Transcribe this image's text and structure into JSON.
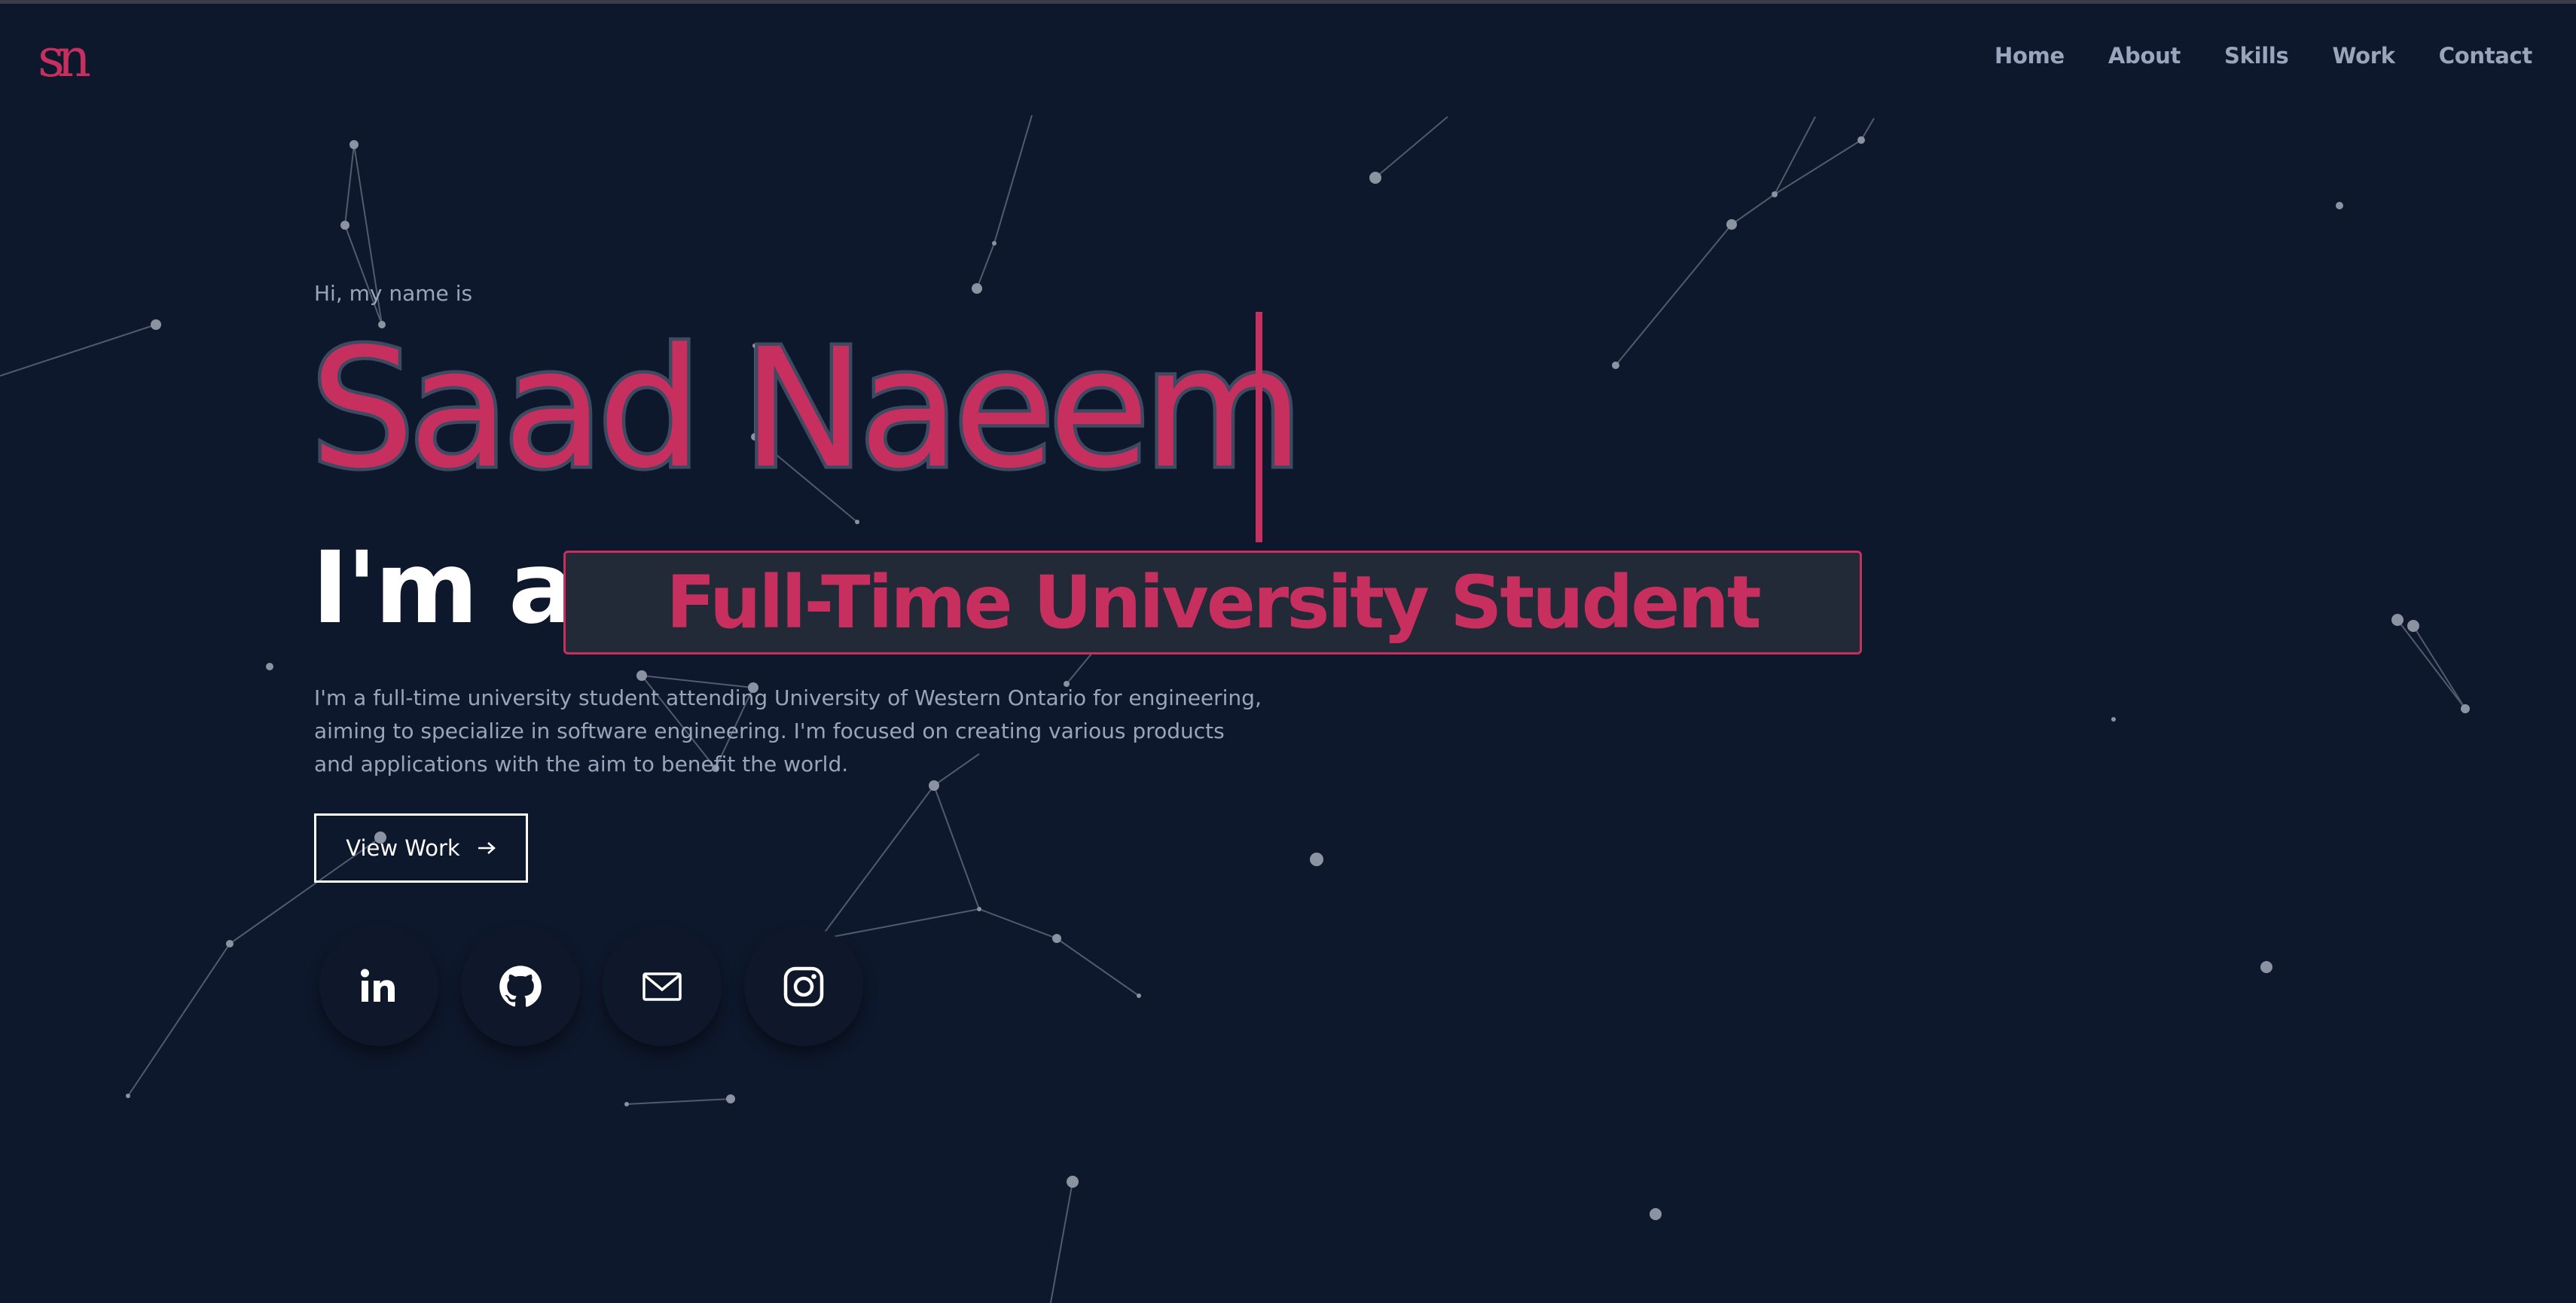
{
  "brand": {
    "logo_text": "sn",
    "accent_color": "#c7305e",
    "background_color": "#0e182c"
  },
  "nav": {
    "items": [
      "Home",
      "About",
      "Skills",
      "Work",
      "Contact"
    ]
  },
  "hero": {
    "greeting": "Hi, my name is",
    "name": "Saad Naeem",
    "intro_prefix": "I'm a",
    "role": "Full-Time University Student",
    "description": "I'm a full-time university student attending University of Western Ontario for engineering, aiming to specialize in software engineering. I'm focused on creating various products and applications with the aim to benefit the world.",
    "cta_label": "View Work",
    "cta_icon": "arrow-right-icon"
  },
  "socials": [
    {
      "name": "linkedin",
      "icon": "linkedin-icon"
    },
    {
      "name": "github",
      "icon": "github-icon"
    },
    {
      "name": "email",
      "icon": "mail-icon"
    },
    {
      "name": "instagram",
      "icon": "instagram-icon"
    }
  ]
}
